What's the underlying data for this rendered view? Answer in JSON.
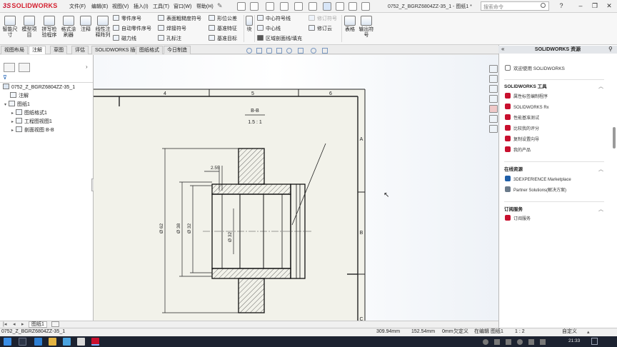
{
  "app": {
    "logo_brand": "SOLIDWORKS",
    "document_title": "0752_Z_BGRZ6804ZZ-35_1 - 图纸1 *",
    "search_placeholder": "搜索命令"
  },
  "menu": [
    "文件(F)",
    "编辑(E)",
    "视图(V)",
    "插入(I)",
    "工具(T)",
    "窗口(W)",
    "帮助(H)"
  ],
  "ribbon": {
    "big_buttons": [
      "智能尺寸",
      "模型项目",
      "拼写检验程序",
      "格式涂刷器",
      "注释",
      "线性注释阵列"
    ],
    "group1": [
      "零件序号",
      "自动零件序号",
      "磁力线"
    ],
    "group2": [
      "表面粗糙度符号",
      "焊接符号",
      "孔标注"
    ],
    "group3": [
      "形位公差",
      "基准特征",
      "基准目标"
    ],
    "group4_label": "块",
    "group5": [
      "中心符号线",
      "中心线",
      "区域剖面线/填充"
    ],
    "group6": [
      "修订符号",
      "修订云"
    ],
    "big_right": [
      "表格",
      "输出符号"
    ]
  },
  "tabs": [
    "视图布局",
    "注解",
    "草图",
    "评估",
    "SOLIDWORKS 插件",
    "图纸格式",
    "今日制造"
  ],
  "active_tab": 1,
  "tree": {
    "root": "0752_Z_BGRZ6804ZZ-35_1",
    "items": [
      "注解",
      "图纸1",
      "图纸格式1",
      "工程图视图1",
      "剖面视图 B-B"
    ]
  },
  "drawing": {
    "zone_columns": [
      "4",
      "5",
      "6"
    ],
    "zone_rows": [
      "A",
      "B",
      "C"
    ],
    "section_title": "B-B",
    "scale": "1.5 : 1",
    "dims": [
      "2.55",
      "Ø 62",
      "Ø 38",
      "Ø 32",
      "Ø 32"
    ]
  },
  "right_panel": {
    "title": "SOLIDWORKS 资源",
    "welcome": "欢迎使用 SOLIDWORKS",
    "tools_header": "SOLIDWORKS 工具",
    "tools": [
      "属性标签编制程序",
      "SOLIDWORKS Rx",
      "性能基准测试",
      "比较我的评分",
      "复制设置向导",
      "我的产品"
    ],
    "online_header": "在线资源",
    "online": [
      "3DEXPERIENCE Marketplace",
      "Partner Solutions(解决方案)"
    ],
    "sub_header": "订阅服务",
    "sub": [
      "订阅服务"
    ]
  },
  "sheet_tab": "图纸1",
  "status": {
    "file": "0752_Z_BGRZ6804ZZ-35_1",
    "x": "309.94mm",
    "y": "152.54mm",
    "z": "0mm",
    "define": "欠定义",
    "editing": "在编辑 图纸1",
    "scale": "1 : 2",
    "custom": "自定义"
  },
  "taskbar": {
    "time": "21:33"
  },
  "colors": {
    "accent": "#c8102e",
    "hatch": "#333333"
  }
}
